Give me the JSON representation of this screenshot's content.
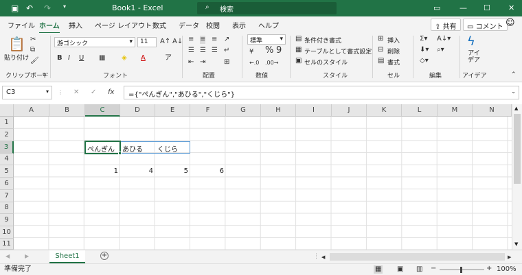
{
  "title_bar": {
    "workbook_title": "Book1  -  Excel",
    "search_placeholder": "検索",
    "autosave_icon": "save-icon",
    "undo_icon": "undo-icon",
    "redo_icon": "redo-icon"
  },
  "ribbon_tabs": {
    "items": [
      "ファイル",
      "ホーム",
      "挿入",
      "ページ レイアウト",
      "数式",
      "データ",
      "校閲",
      "表示",
      "ヘルプ"
    ],
    "active": "ホーム",
    "share_label": "共有",
    "comment_label": "コメント"
  },
  "ribbon": {
    "clipboard": {
      "paste_label": "貼り付け",
      "group_label": "クリップボード"
    },
    "font": {
      "font_name": "游ゴシック",
      "font_size": "11",
      "bold": "B",
      "italic": "I",
      "underline": "U",
      "group_label": "フォント"
    },
    "alignment": {
      "group_label": "配置"
    },
    "number": {
      "format": "標準",
      "percent": "%",
      "comma": "9",
      "group_label": "数値"
    },
    "styles": {
      "conditional": "条件付き書式",
      "table": "テーブルとして書式設定",
      "cell_styles": "セルのスタイル",
      "group_label": "スタイル"
    },
    "cells": {
      "insert": "挿入",
      "delete": "削除",
      "format": "書式",
      "group_label": "セル"
    },
    "editing": {
      "group_label": "編集"
    },
    "ideas": {
      "label": "アイ\nデア",
      "group_label": "アイデア"
    }
  },
  "formula_bar": {
    "name_box": "C3",
    "cancel": "✕",
    "enter": "✓",
    "fx": "fx",
    "formula": "={\"ぺんぎん\",\"あひる\",\"くじら\"}"
  },
  "grid": {
    "columns": [
      "A",
      "B",
      "C",
      "D",
      "E",
      "F",
      "G",
      "H",
      "I",
      "J",
      "K",
      "L",
      "M",
      "N"
    ],
    "rows": [
      "1",
      "2",
      "3",
      "4",
      "5",
      "6",
      "7",
      "8",
      "9",
      "10",
      "11"
    ],
    "selected_cell": "C3",
    "cells": {
      "C3": "ぺんぎん",
      "D3": "あひる",
      "E3": "くじら",
      "C5": "1",
      "D5": "4",
      "E5": "5",
      "F5": "6"
    }
  },
  "sheet_tabs": {
    "items": [
      "Sheet1"
    ],
    "add_label": "+"
  },
  "status_bar": {
    "status": "準備完了",
    "zoom": "100%",
    "zoom_minus": "−",
    "zoom_plus": "+"
  }
}
